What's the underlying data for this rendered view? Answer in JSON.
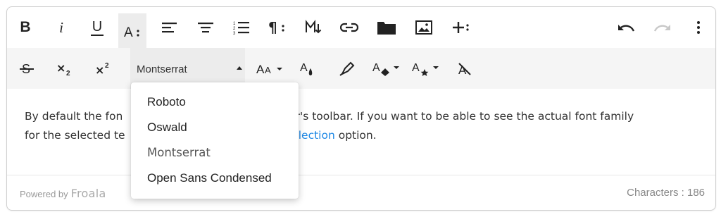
{
  "toolbar": {
    "row1": [
      "bold-icon",
      "italic-icon",
      "underline-icon",
      "font-size-icon",
      "align-left-icon",
      "align-center-icon",
      "ordered-list-icon",
      "paragraph-format-icon",
      "markdown-icon",
      "link-icon",
      "folder-icon",
      "image-icon",
      "more-insert-icon"
    ],
    "bold": "B",
    "italic": "i",
    "underline": "U",
    "font_family": {
      "selected": "Montserrat",
      "options": [
        "Roboto",
        "Oswald",
        "Montserrat",
        "Open Sans Condensed"
      ]
    }
  },
  "content": {
    "text_before": "By default the fon",
    "text_before_2": "editor's toolbar. If you want to be able to see the actual font family",
    "line2_start": "for the selected te",
    "link": "ilySelection",
    "line2_end": " option."
  },
  "footer": {
    "powered_by": "Powered by",
    "brand": "Froala",
    "characters": "Characters : 186"
  },
  "colors": {
    "link": "#1e88e5",
    "toolbar_active": "#ececec",
    "row2_bg": "#f5f5f5"
  }
}
